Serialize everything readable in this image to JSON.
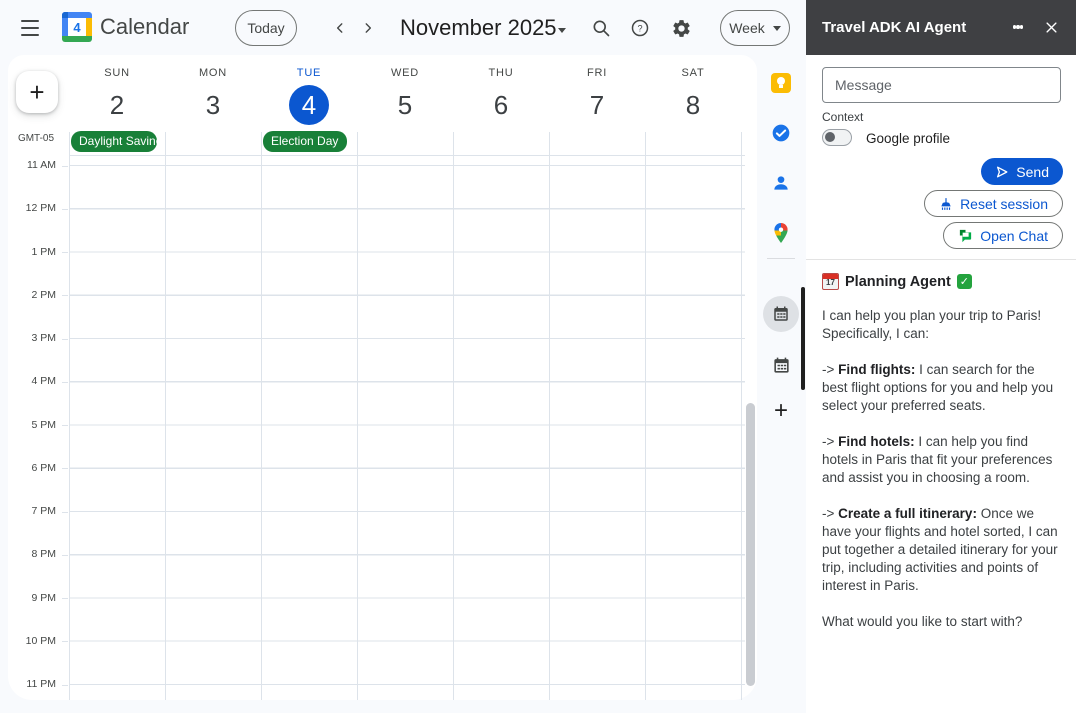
{
  "colors": {
    "accent_blue": "#0b57d0",
    "event_green": "#188038",
    "panel_header_bg": "#3f4043",
    "page_bg": "#f8fafd"
  },
  "header": {
    "app_title": "Calendar",
    "logo_day": "4",
    "today_label": "Today",
    "prev_label": "‹",
    "next_label": "›",
    "current_range": "November 2025",
    "view_selector": "Week"
  },
  "calendar": {
    "timezone": "GMT-05",
    "days": [
      {
        "weekday": "SUN",
        "date": "2",
        "selected": false
      },
      {
        "weekday": "MON",
        "date": "3",
        "selected": false
      },
      {
        "weekday": "TUE",
        "date": "4",
        "selected": true
      },
      {
        "weekday": "WED",
        "date": "5",
        "selected": false
      },
      {
        "weekday": "THU",
        "date": "6",
        "selected": false
      },
      {
        "weekday": "FRI",
        "date": "7",
        "selected": false
      },
      {
        "weekday": "SAT",
        "date": "8",
        "selected": false
      }
    ],
    "all_day_events": [
      {
        "label": "Daylight Saving Time",
        "day": "SUN"
      },
      {
        "label": "Election Day",
        "day": "TUE"
      }
    ],
    "hours": [
      "11 AM",
      "12 PM",
      "1 PM",
      "2 PM",
      "3 PM",
      "4 PM",
      "5 PM",
      "6 PM",
      "7 PM",
      "8 PM",
      "9 PM",
      "10 PM",
      "11 PM"
    ],
    "create_label": "+"
  },
  "app_sidebar": {
    "add_label": "+"
  },
  "panel": {
    "title": "Travel ADK AI Agent",
    "message_placeholder": "Message",
    "context_label": "Context",
    "toggle_label": "Google profile",
    "toggle_state": "off",
    "send_label": "Send",
    "reset_label": "Reset session",
    "open_chat_label": "Open Chat",
    "message": {
      "agent_icon_day": "17",
      "agent_name": "Planning Agent",
      "paragraphs": [
        [
          {
            "t": "I can help you plan your trip to Paris! Specifically, I can:"
          }
        ],
        [
          {
            "t": "-> "
          },
          {
            "t": "Find flights:",
            "b": true
          },
          {
            "t": " I can search for the best flight options for you and help you select your preferred seats."
          }
        ],
        [
          {
            "t": "-> "
          },
          {
            "t": "Find hotels:",
            "b": true
          },
          {
            "t": " I can help you find hotels in Paris that fit your preferences and assist you in choosing a room."
          }
        ],
        [
          {
            "t": "-> "
          },
          {
            "t": "Create a full itinerary:",
            "b": true
          },
          {
            "t": " Once we have your flights and hotel sorted, I can put together a detailed itinerary for your trip, including activities and points of interest in Paris."
          }
        ],
        [
          {
            "t": "What would you like to start with?"
          }
        ]
      ]
    }
  }
}
